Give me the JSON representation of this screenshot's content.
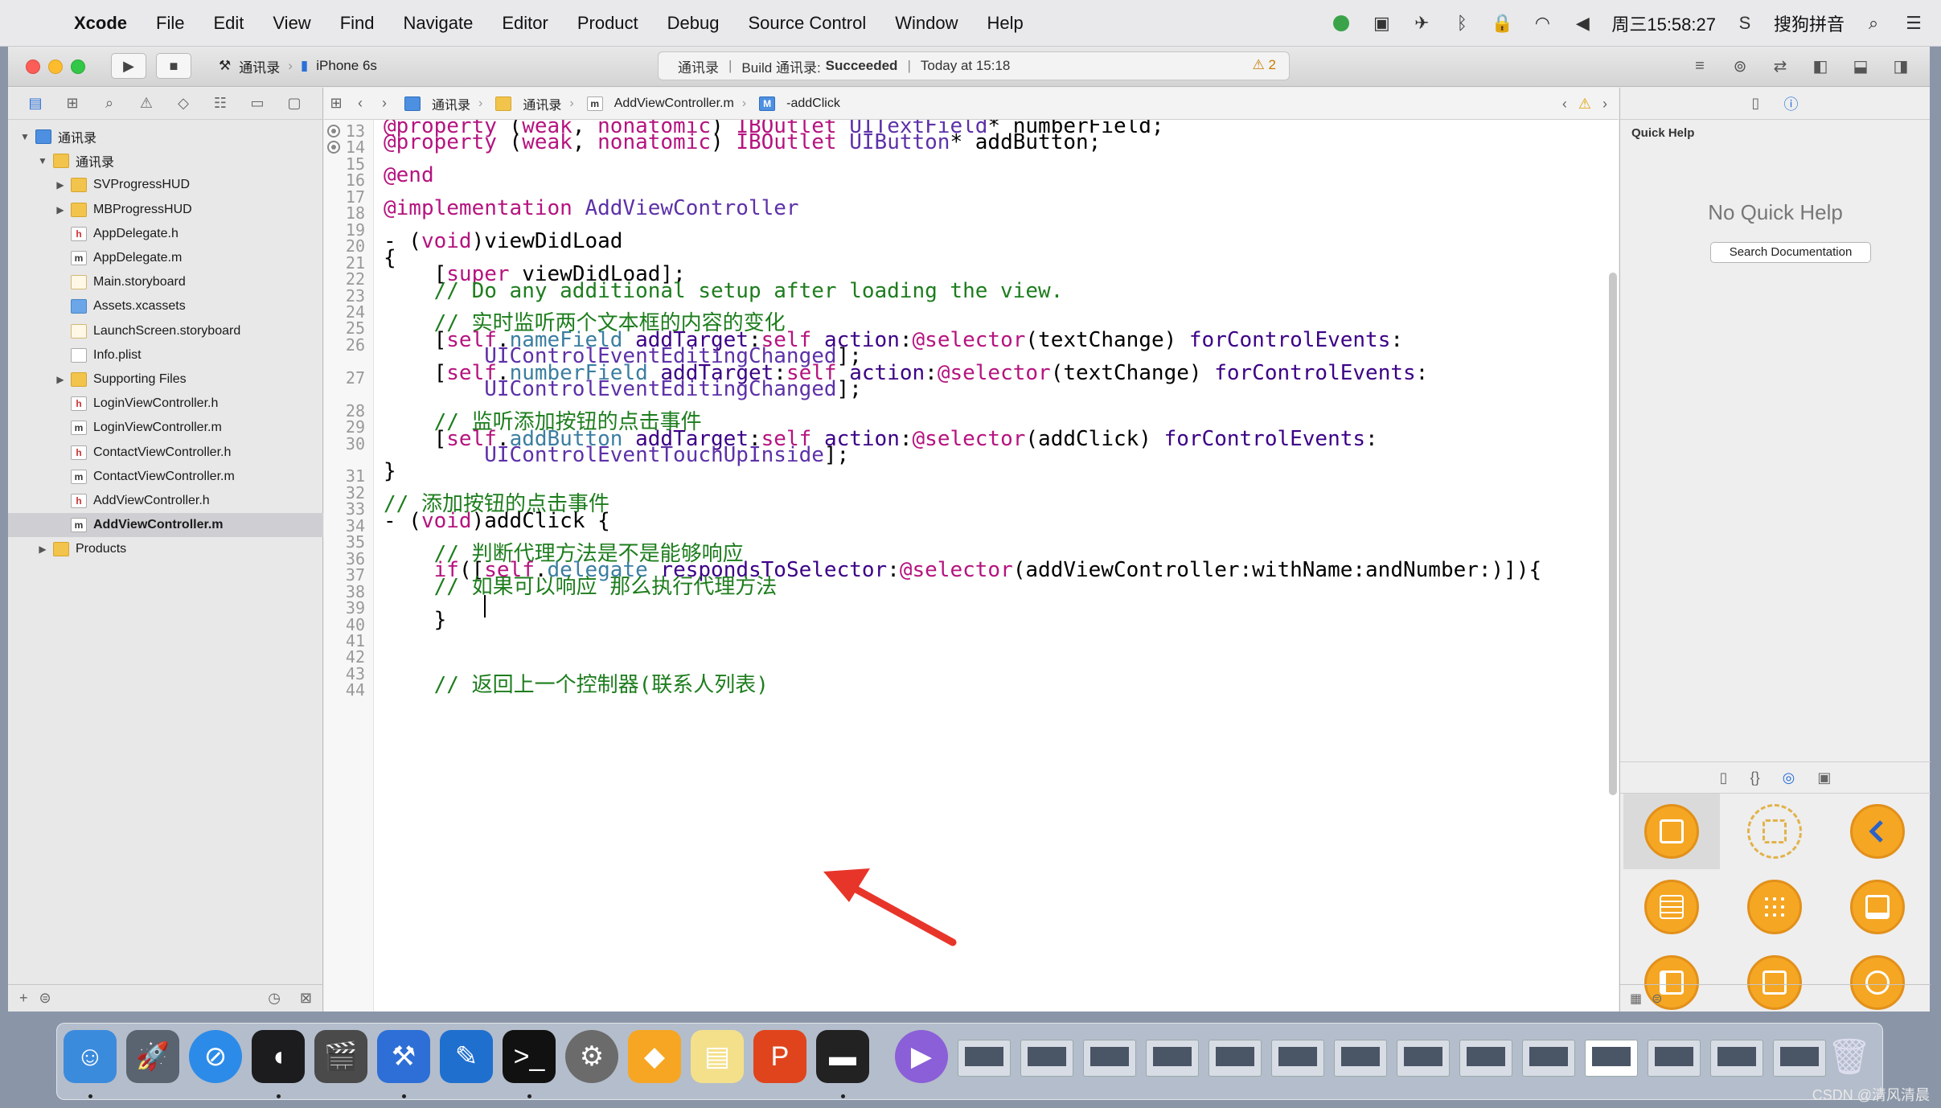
{
  "menubar": {
    "app": "Xcode",
    "items": [
      "File",
      "Edit",
      "View",
      "Find",
      "Navigate",
      "Editor",
      "Product",
      "Debug",
      "Source Control",
      "Window",
      "Help"
    ],
    "clock": "周三15:58:27",
    "input_method": "搜狗拼音"
  },
  "toolbar": {
    "scheme": "通讯录",
    "device": "iPhone 6s",
    "activity_project": "通讯录",
    "build_prefix": "Build 通讯录:",
    "build_status": "Succeeded",
    "build_time": "Today at 15:18",
    "warnings": "2"
  },
  "navigator": {
    "items": [
      {
        "label": "通讯录",
        "icon": "project-icon",
        "level": 0,
        "disc": "▼"
      },
      {
        "label": "通讯录",
        "icon": "folder-icon",
        "level": 1,
        "disc": "▼"
      },
      {
        "label": "SVProgressHUD",
        "icon": "folder-icon",
        "level": 2,
        "disc": "▶"
      },
      {
        "label": "MBProgressHUD",
        "icon": "folder-icon",
        "level": 2,
        "disc": "▶"
      },
      {
        "label": "AppDelegate.h",
        "icon": "h-file-icon",
        "level": 2,
        "disc": ""
      },
      {
        "label": "AppDelegate.m",
        "icon": "m-file-icon",
        "level": 2,
        "disc": ""
      },
      {
        "label": "Main.storyboard",
        "icon": "storyboard-icon",
        "level": 2,
        "disc": ""
      },
      {
        "label": "Assets.xcassets",
        "icon": "assets-icon",
        "level": 2,
        "disc": ""
      },
      {
        "label": "LaunchScreen.storyboard",
        "icon": "storyboard-icon",
        "level": 2,
        "disc": ""
      },
      {
        "label": "Info.plist",
        "icon": "plist-icon",
        "level": 2,
        "disc": ""
      },
      {
        "label": "Supporting Files",
        "icon": "folder-icon",
        "level": 2,
        "disc": "▶"
      },
      {
        "label": "LoginViewController.h",
        "icon": "h-file-icon",
        "level": 2,
        "disc": ""
      },
      {
        "label": "LoginViewController.m",
        "icon": "m-file-icon",
        "level": 2,
        "disc": ""
      },
      {
        "label": "ContactViewController.h",
        "icon": "h-file-icon",
        "level": 2,
        "disc": ""
      },
      {
        "label": "ContactViewController.m",
        "icon": "m-file-icon",
        "level": 2,
        "disc": ""
      },
      {
        "label": "AddViewController.h",
        "icon": "h-file-icon",
        "level": 2,
        "disc": ""
      },
      {
        "label": "AddViewController.m",
        "icon": "m-file-icon",
        "level": 2,
        "disc": "",
        "selected": true
      },
      {
        "label": "Products",
        "icon": "folder-icon",
        "level": 1,
        "disc": "▶"
      }
    ]
  },
  "jumpbar": {
    "crumbs": [
      "通讯录",
      "通讯录",
      "AddViewController.m",
      "-addClick"
    ]
  },
  "editor": {
    "line_numbers": [
      "13",
      "14",
      "15",
      "16",
      "17",
      "18",
      "19",
      "20",
      "21",
      "22",
      "23",
      "24",
      "25",
      "26",
      "",
      "27",
      "",
      "28",
      "29",
      "30",
      "",
      "31",
      "32",
      "33",
      "34",
      "35",
      "36",
      "37",
      "38",
      "39",
      "40",
      "41",
      "42",
      "43",
      "44"
    ],
    "lines": [
      "@property (weak, nonatomic) IBOutlet UITextField* numberField;",
      "@property (weak, nonatomic) IBOutlet UIButton* addButton;",
      "",
      "@end",
      "",
      "@implementation AddViewController",
      "",
      "- (void)viewDidLoad",
      "{",
      "    [super viewDidLoad];",
      "    // Do any additional setup after loading the view.",
      "",
      "    // 实时监听两个文本框的内容的变化",
      "    [self.nameField addTarget:self action:@selector(textChange) forControlEvents:",
      "        UIControlEventEditingChanged];",
      "    [self.numberField addTarget:self action:@selector(textChange) forControlEvents:",
      "        UIControlEventEditingChanged];",
      "",
      "    // 监听添加按钮的点击事件",
      "    [self.addButton addTarget:self action:@selector(addClick) forControlEvents:",
      "        UIControlEventTouchUpInside];",
      "}",
      "",
      "// 添加按钮的点击事件",
      "- (void)addClick {",
      "",
      "    // 判断代理方法是不是能够响应",
      "    if([self.delegate respondsToSelector:@selector(addViewController:withName:andNumber:)]){",
      "    // 如果可以响应 那么执行代理方法",
      "        ",
      "    }",
      "",
      "",
      "",
      "    // 返回上一个控制器(联系人列表)"
    ]
  },
  "inspector": {
    "title": "Quick Help",
    "empty_text": "No Quick Help",
    "search_button": "Search Documentation"
  },
  "watermark": "CSDN @清风清晨",
  "colors": {
    "keyword": "#b5137f",
    "comment": "#1d7d1d",
    "annotation_arrow": "#e8352a"
  }
}
